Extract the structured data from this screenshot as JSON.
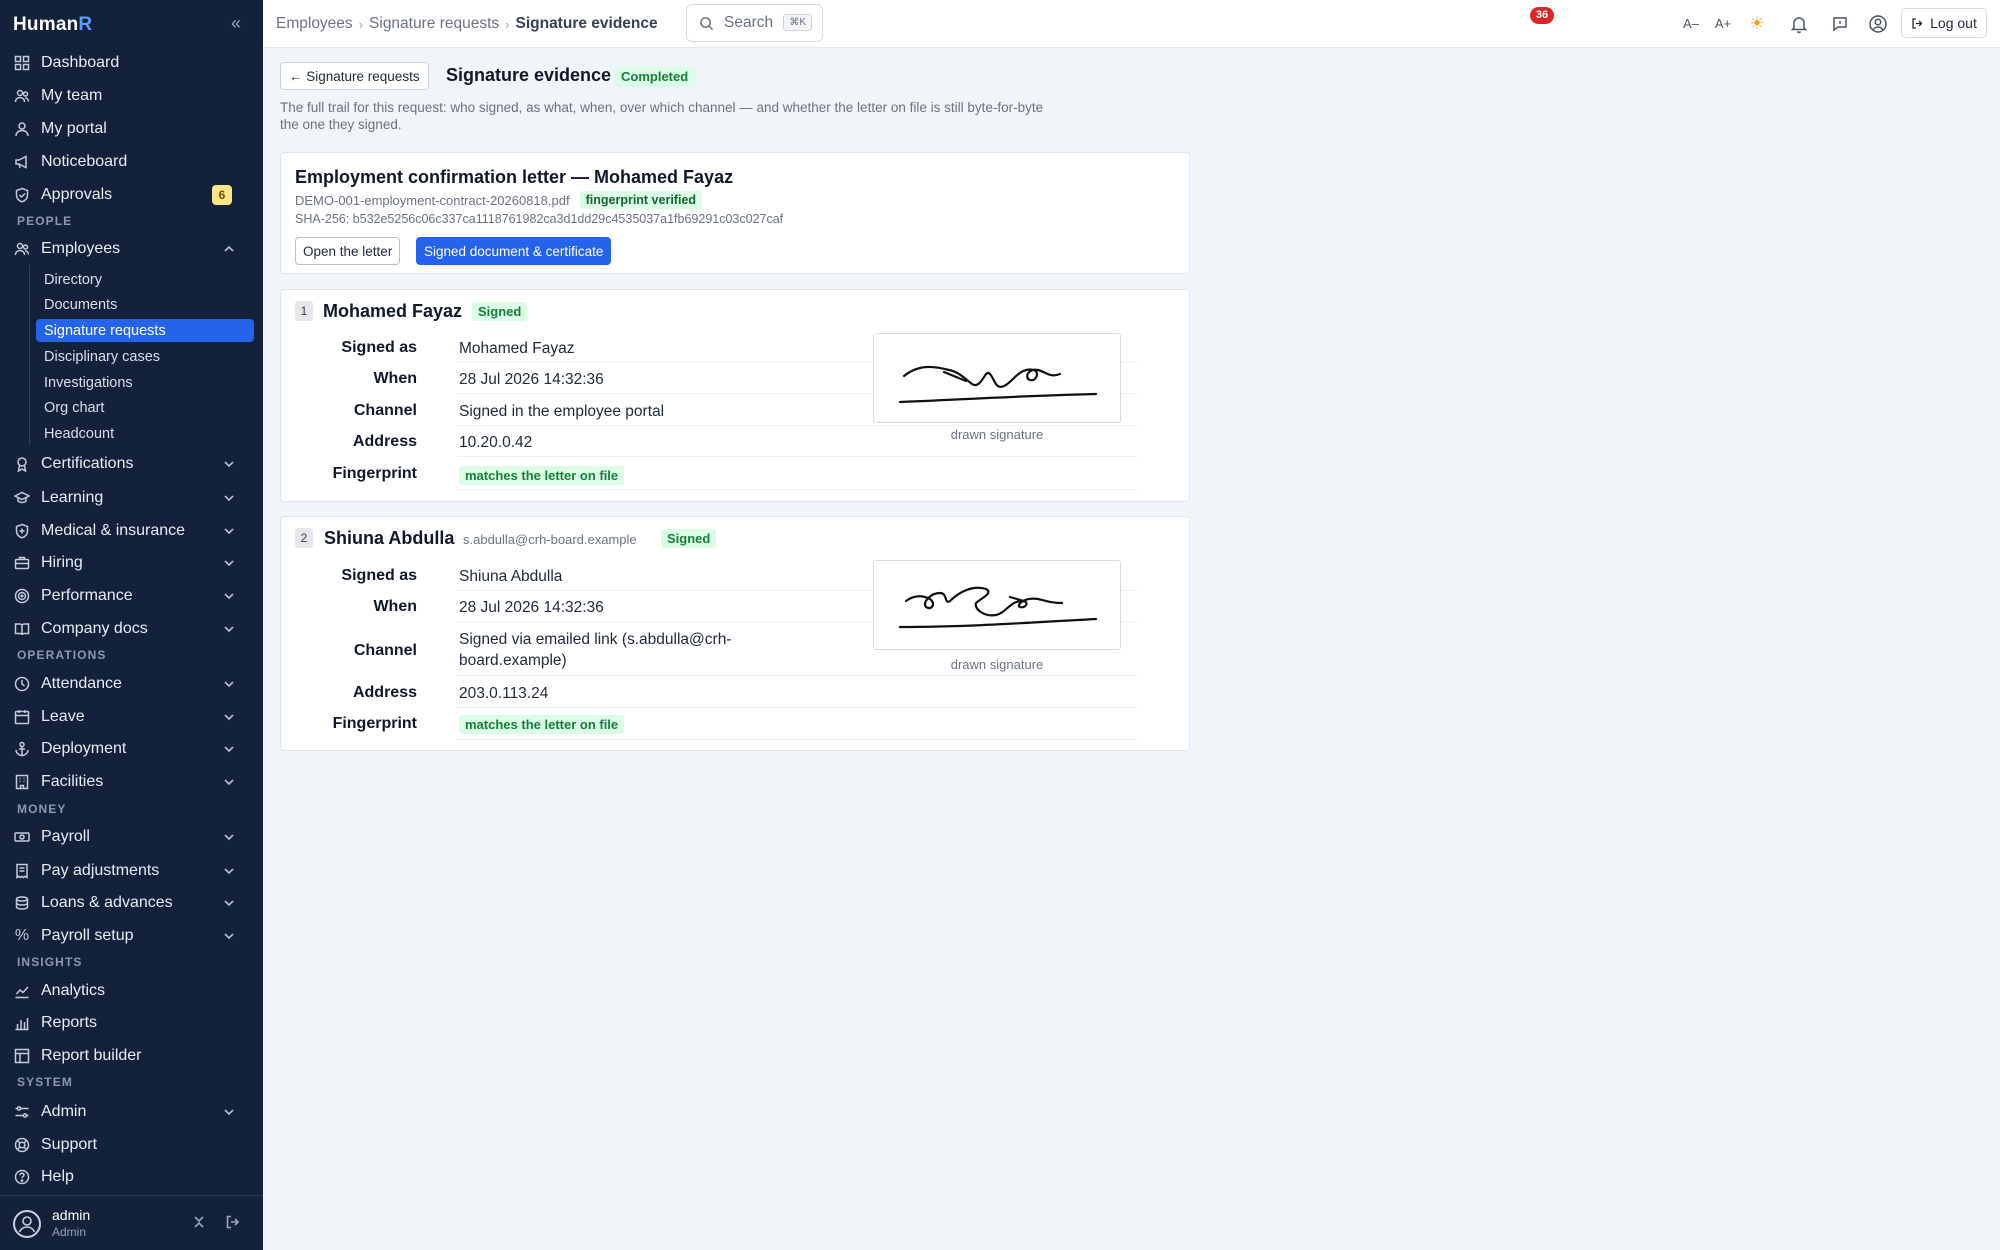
{
  "app": {
    "brand_main": "Human",
    "brand_accent": "R"
  },
  "sidebar": {
    "main": [
      {
        "label": "Dashboard",
        "icon": "dashboard-icon"
      },
      {
        "label": "My team",
        "icon": "team-icon"
      },
      {
        "label": "My portal",
        "icon": "user-icon"
      },
      {
        "label": "Noticeboard",
        "icon": "megaphone-icon"
      },
      {
        "label": "Approvals",
        "icon": "shield-check-icon",
        "badge": "6"
      }
    ],
    "sections": {
      "people": "PEOPLE",
      "operations": "OPERATIONS",
      "money": "MONEY",
      "insights": "INSIGHTS",
      "system": "SYSTEM"
    },
    "employees": {
      "label": "Employees",
      "children": [
        "Directory",
        "Documents",
        "Signature requests",
        "Disciplinary cases",
        "Investigations",
        "Org chart",
        "Headcount"
      ],
      "active": "Signature requests"
    },
    "people_rest": [
      "Certifications",
      "Learning",
      "Medical & insurance",
      "Hiring",
      "Performance",
      "Company docs"
    ],
    "operations": [
      "Attendance",
      "Leave",
      "Deployment",
      "Facilities"
    ],
    "money": [
      "Payroll",
      "Pay adjustments",
      "Loans & advances",
      "Payroll setup"
    ],
    "insights": [
      "Analytics",
      "Reports",
      "Report builder"
    ],
    "system": [
      "Admin",
      "Support",
      "Help"
    ],
    "user": {
      "name": "admin",
      "role": "Admin"
    }
  },
  "topbar": {
    "breadcrumb": [
      "Employees",
      "Signature requests",
      "Signature evidence"
    ],
    "search_label": "Search",
    "search_shortcut": "⌘K",
    "font_decrease": "A–",
    "font_increase": "A+",
    "notifications_count": "36",
    "logout_label": "Log out"
  },
  "page": {
    "back_label": "← Signature requests",
    "title": "Signature evidence",
    "status": "Completed",
    "intro": "The full trail for this request: who signed, as what, when, over which channel — and whether the letter on file is still byte-for-byte the one they signed."
  },
  "document": {
    "title": "Employment confirmation letter — Mohamed Fayaz",
    "file_name": "DEMO-001-employment-contract-20260818.pdf",
    "verified_tag": "fingerprint verified",
    "sha": "SHA-256: b532e5256c06c337ca1118761982ca3d1dd29c4535037a1fb69291c03c027caf",
    "open_button": "Open the letter",
    "certificate_button": "Signed document & certificate"
  },
  "labels": {
    "signed_as": "Signed as",
    "when": "When",
    "channel": "Channel",
    "address": "Address",
    "fingerprint": "Fingerprint"
  },
  "signers": [
    {
      "number": "1",
      "name": "Mohamed Fayaz",
      "email": "",
      "status": "Signed",
      "signed_as": "Mohamed Fayaz",
      "when": "28 Jul 2026 14:32:36",
      "channel": "Signed in the employee portal",
      "address": "10.20.0.42",
      "fingerprint": "matches the letter on file",
      "signature_caption": "drawn signature"
    },
    {
      "number": "2",
      "name": "Shiuna Abdulla",
      "email": "s.abdulla@crh-board.example",
      "status": "Signed",
      "signed_as": "Shiuna Abdulla",
      "when": "28 Jul 2026 14:32:36",
      "channel": "Signed via emailed link (s.abdulla@crh-board.example)",
      "address": "203.0.113.24",
      "fingerprint": "matches the letter on file",
      "signature_caption": "drawn signature"
    }
  ],
  "colors": {
    "sidebar_bg": "#13213a",
    "accent": "#2563eb",
    "success_bg": "#dcfce7",
    "success_text": "#15803d",
    "badge_red": "#dc2626"
  }
}
